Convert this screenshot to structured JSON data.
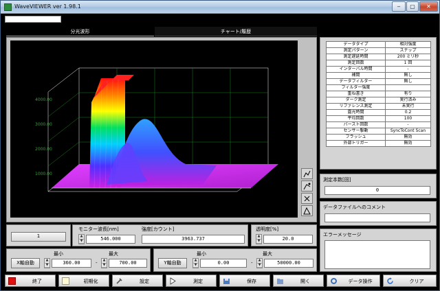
{
  "window": {
    "title": "WaveVIEWER ver 1.98.1"
  },
  "tabs": [
    {
      "label": "分光波形"
    },
    {
      "label": "チャート/履歴"
    }
  ],
  "chart_data": {
    "type": "surface3d",
    "description_ticks": [
      "4000.00",
      "3000.00",
      "2000.00",
      "1000.00"
    ],
    "peaks": [
      {
        "wavelength_nm": 546,
        "intensity": 3963.737
      }
    ]
  },
  "params": {
    "rows": [
      {
        "key": "データタイプ",
        "value": "相対強度"
      },
      {
        "key": "測定パターン",
        "value": "スナップ"
      },
      {
        "key": "測定遅延時間",
        "value": "200 ミリ秒"
      },
      {
        "key": "測定回数",
        "value": "1 回"
      },
      {
        "key": "インターバル時間",
        "value": "-"
      },
      {
        "key": "補間",
        "value": "無し"
      },
      {
        "key": "データフィルター",
        "value": "無し"
      },
      {
        "key": "フィルター強度",
        "value": ""
      },
      {
        "key": "重ね書き",
        "value": "有り"
      },
      {
        "key": "ダーク測定",
        "value": "実行済み"
      },
      {
        "key": "リファレンス測定",
        "value": "未実行"
      },
      {
        "key": "露光時間",
        "value": "0.2"
      },
      {
        "key": "平均回数",
        "value": "100"
      },
      {
        "key": "バースト回数",
        "value": "-"
      },
      {
        "key": "センサー駆動",
        "value": "SyncToCont Scan"
      },
      {
        "key": "フラッシュ",
        "value": "無効"
      },
      {
        "key": "外部トリガー",
        "value": "無効"
      }
    ]
  },
  "measure_count": {
    "label": "測定本数[回]",
    "value": "0"
  },
  "comment": {
    "label": "データファイルへのコメント",
    "value": ""
  },
  "error": {
    "label": "エラーメッセージ",
    "value": ""
  },
  "monitor": {
    "index_value": "1",
    "wavelength_label": "モニター波長[nm]",
    "wavelength_value": "546.000",
    "intensity_label": "強度[カウント]",
    "intensity_value": "3963.737",
    "transparency_label": "透明度[%]",
    "transparency_value": "20.0"
  },
  "x_axis": {
    "auto_button": "X軸自動",
    "min_label": "最小",
    "min_value": "360.00",
    "dash": "-",
    "max_label": "最大",
    "max_value": "700.00"
  },
  "y_axis": {
    "auto_button": "Y軸自動",
    "min_label": "最小",
    "min_value": "0.00",
    "dash": "-",
    "max_label": "最大",
    "max_value": "50000.00"
  },
  "toolbar": {
    "exit": "終了",
    "init": "初期化",
    "settings": "設定",
    "measure": "測定",
    "save": "保存",
    "open": "開く",
    "data_op": "データ操作",
    "clear": "クリア"
  },
  "colors": {
    "accent_red": "#e01010",
    "panel": "#d4d4d4",
    "titlebar": "#b5cde6"
  }
}
